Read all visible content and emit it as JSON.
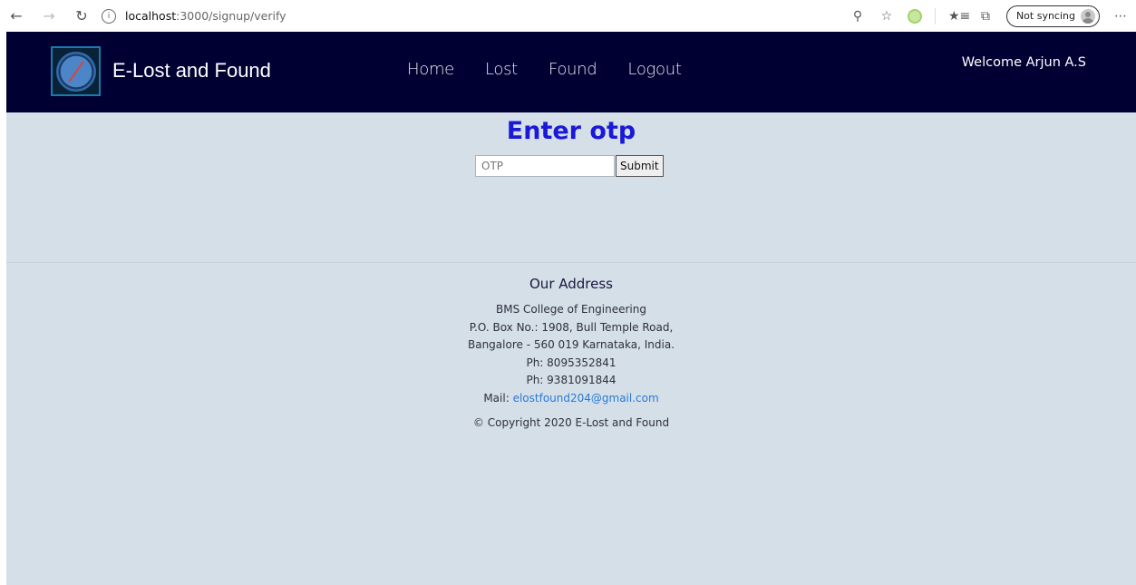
{
  "browser": {
    "url_host": "localhost",
    "url_path": ":3000/signup/verify",
    "sync_label": "Not syncing"
  },
  "navbar": {
    "brand": "E-Lost and Found",
    "links": [
      "Home",
      "Lost",
      "Found",
      "Logout"
    ],
    "welcome": "Welcome Arjun A.S"
  },
  "otp": {
    "title": "Enter otp",
    "placeholder": "OTP",
    "submit_label": "Submit"
  },
  "footer": {
    "heading": "Our Address",
    "lines": [
      "BMS College of Engineering",
      "P.O. Box No.: 1908, Bull Temple Road,",
      "Bangalore - 560 019 Karnataka, India.",
      "Ph: 8095352841",
      "Ph: 9381091844"
    ],
    "mail_label": "Mail:",
    "mail_link": "elostfound204@gmail.com",
    "copyright": "© Copyright 2020 E-Lost and Found"
  },
  "colors": {
    "navbar_bg": "#000033",
    "page_bg": "#d5dfe8",
    "title_color": "#1a1ad6",
    "link_color": "#2a7ad8"
  }
}
